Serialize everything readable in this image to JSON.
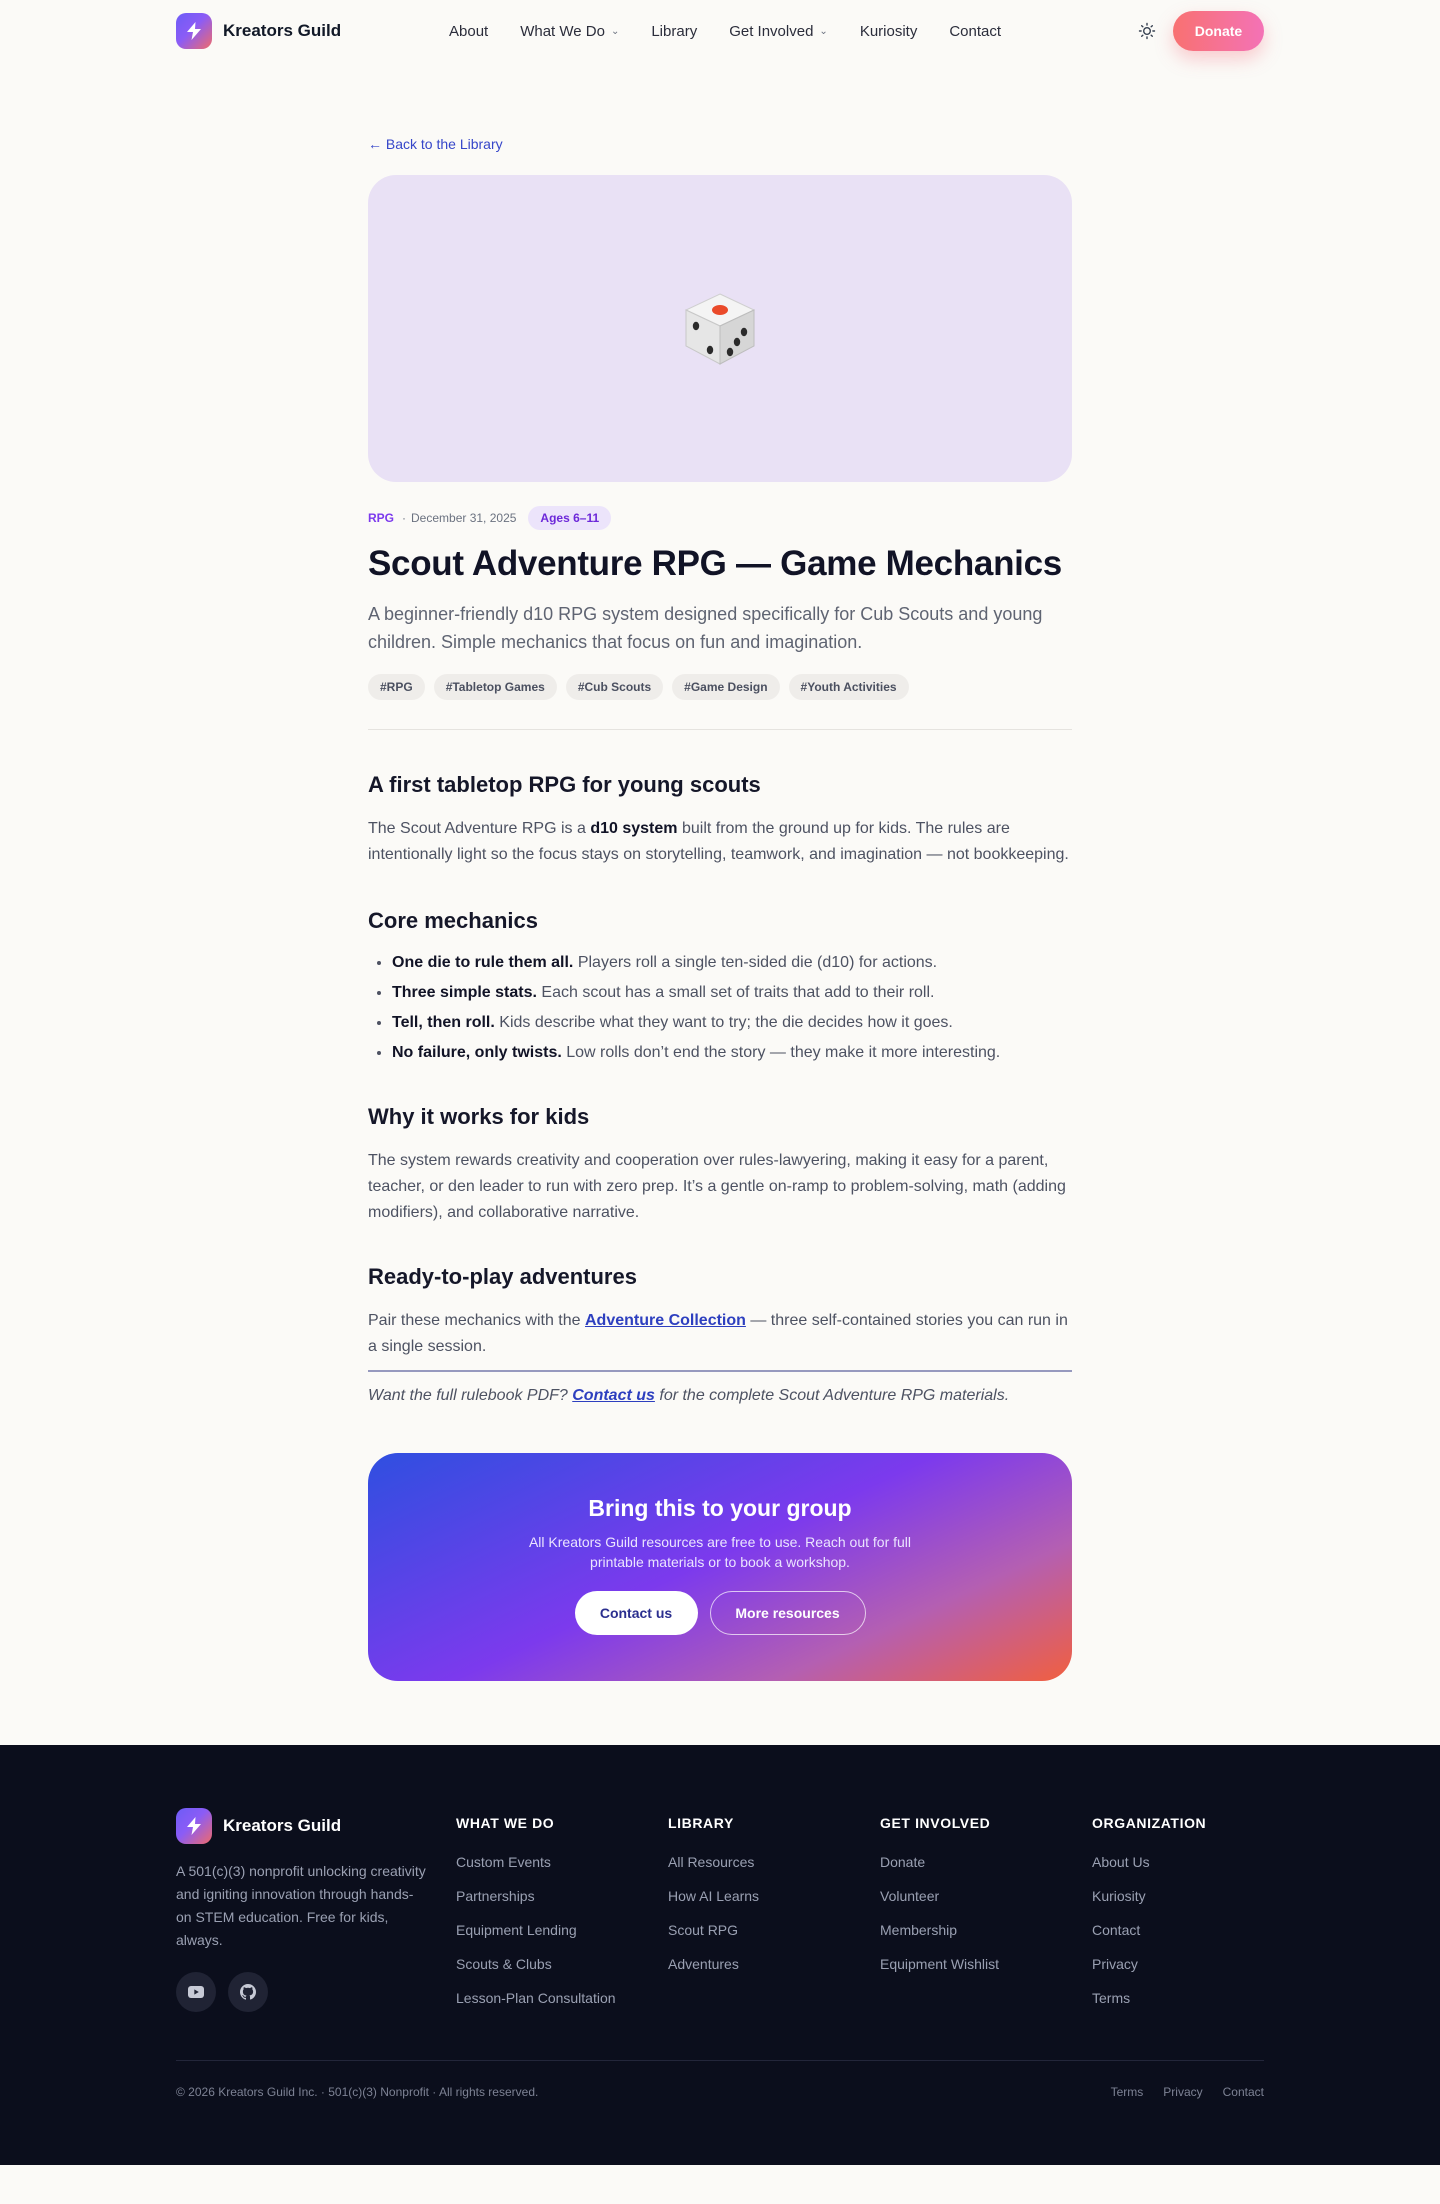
{
  "header": {
    "brand": "Kreators Guild",
    "nav": [
      {
        "label": "About",
        "dropdown": false
      },
      {
        "label": "What We Do",
        "dropdown": true
      },
      {
        "label": "Library",
        "dropdown": false
      },
      {
        "label": "Get Involved",
        "dropdown": true
      },
      {
        "label": "Kuriosity",
        "dropdown": false
      },
      {
        "label": "Contact",
        "dropdown": false
      }
    ],
    "theme_icon": "sun-icon",
    "donate_label": "Donate"
  },
  "article": {
    "back_link": "← Back to the Library",
    "hero_icon": "dice-icon",
    "hero_bg": "#e9e1f5",
    "category": "RPG",
    "date": "December 31, 2025",
    "ages": "Ages 6–11",
    "title": "Scout Adventure RPG — Game Mechanics",
    "subtitle": "A beginner-friendly d10 RPG system designed specifically for Cub Scouts and young children. Simple mechanics that focus on fun and imagination.",
    "tags": [
      "#RPG",
      "#Tabletop Games",
      "#Cub Scouts",
      "#Game Design",
      "#Youth Activities"
    ],
    "s1": {
      "heading": "A first tabletop RPG for young scouts",
      "p_before": "The Scout Adventure RPG is a ",
      "p_bold": "d10 system",
      "p_after": " built from the ground up for kids. The rules are intentionally light so the focus stays on storytelling, teamwork, and imagination — not bookkeeping."
    },
    "s2": {
      "heading": "Core mechanics",
      "items": [
        {
          "bold": "One die to rule them all.",
          "text": " Players roll a single ten-sided die (d10) for actions."
        },
        {
          "bold": "Three simple stats.",
          "text": " Each scout has a small set of traits that add to their roll."
        },
        {
          "bold": "Tell, then roll.",
          "text": " Kids describe what they want to try; the die decides how it goes."
        },
        {
          "bold": "No failure, only twists.",
          "text": " Low rolls don’t end the story — they make it more interesting."
        }
      ]
    },
    "s3": {
      "heading": "Why it works for kids",
      "p": "The system rewards creativity and cooperation over rules-lawyering, making it easy for a parent, teacher, or den leader to run with zero prep. It’s a gentle on-ramp to problem-solving, math (adding modifiers), and collaborative narrative."
    },
    "s4": {
      "heading": "Ready-to-play adventures",
      "p_before": "Pair these mechanics with the ",
      "p_link": "Adventure Collection",
      "p_after": " — three self-contained stories you can run in a single session."
    },
    "quote": {
      "before": "Want the full rulebook PDF? ",
      "link": "Contact us",
      "after": " for the complete Scout Adventure RPG materials."
    }
  },
  "cta": {
    "title": "Bring this to your group",
    "text": "All Kreators Guild resources are free to use. Reach out for full printable materials or to book a workshop.",
    "primary": "Contact us",
    "secondary": "More resources"
  },
  "footer": {
    "brand": "Kreators Guild",
    "description": "A 501(c)(3) nonprofit unlocking creativity and igniting innovation through hands-on STEM education. Free for kids, always.",
    "socials": [
      "youtube-icon",
      "github-icon"
    ],
    "columns": [
      {
        "heading": "WHAT WE DO",
        "links": [
          "Custom Events",
          "Partnerships",
          "Equipment Lending",
          "Scouts & Clubs",
          "Lesson-Plan Consultation"
        ]
      },
      {
        "heading": "LIBRARY",
        "links": [
          "All Resources",
          "How AI Learns",
          "Scout RPG",
          "Adventures"
        ]
      },
      {
        "heading": "GET INVOLVED",
        "links": [
          "Donate",
          "Volunteer",
          "Membership",
          "Equipment Wishlist"
        ]
      },
      {
        "heading": "ORGANIZATION",
        "links": [
          "About Us",
          "Kuriosity",
          "Contact",
          "Privacy",
          "Terms"
        ]
      }
    ],
    "copyright": "© 2026 Kreators Guild Inc. · 501(c)(3) Nonprofit · All rights reserved.",
    "legal": [
      "Terms",
      "Privacy",
      "Contact"
    ]
  },
  "colors": {
    "accent": "#7c3aed",
    "link": "#3646c9",
    "donate_start": "#f87171",
    "donate_end": "#f472b6",
    "footer_bg": "#0b0e1c",
    "page_bg": "#fbfaf7"
  }
}
